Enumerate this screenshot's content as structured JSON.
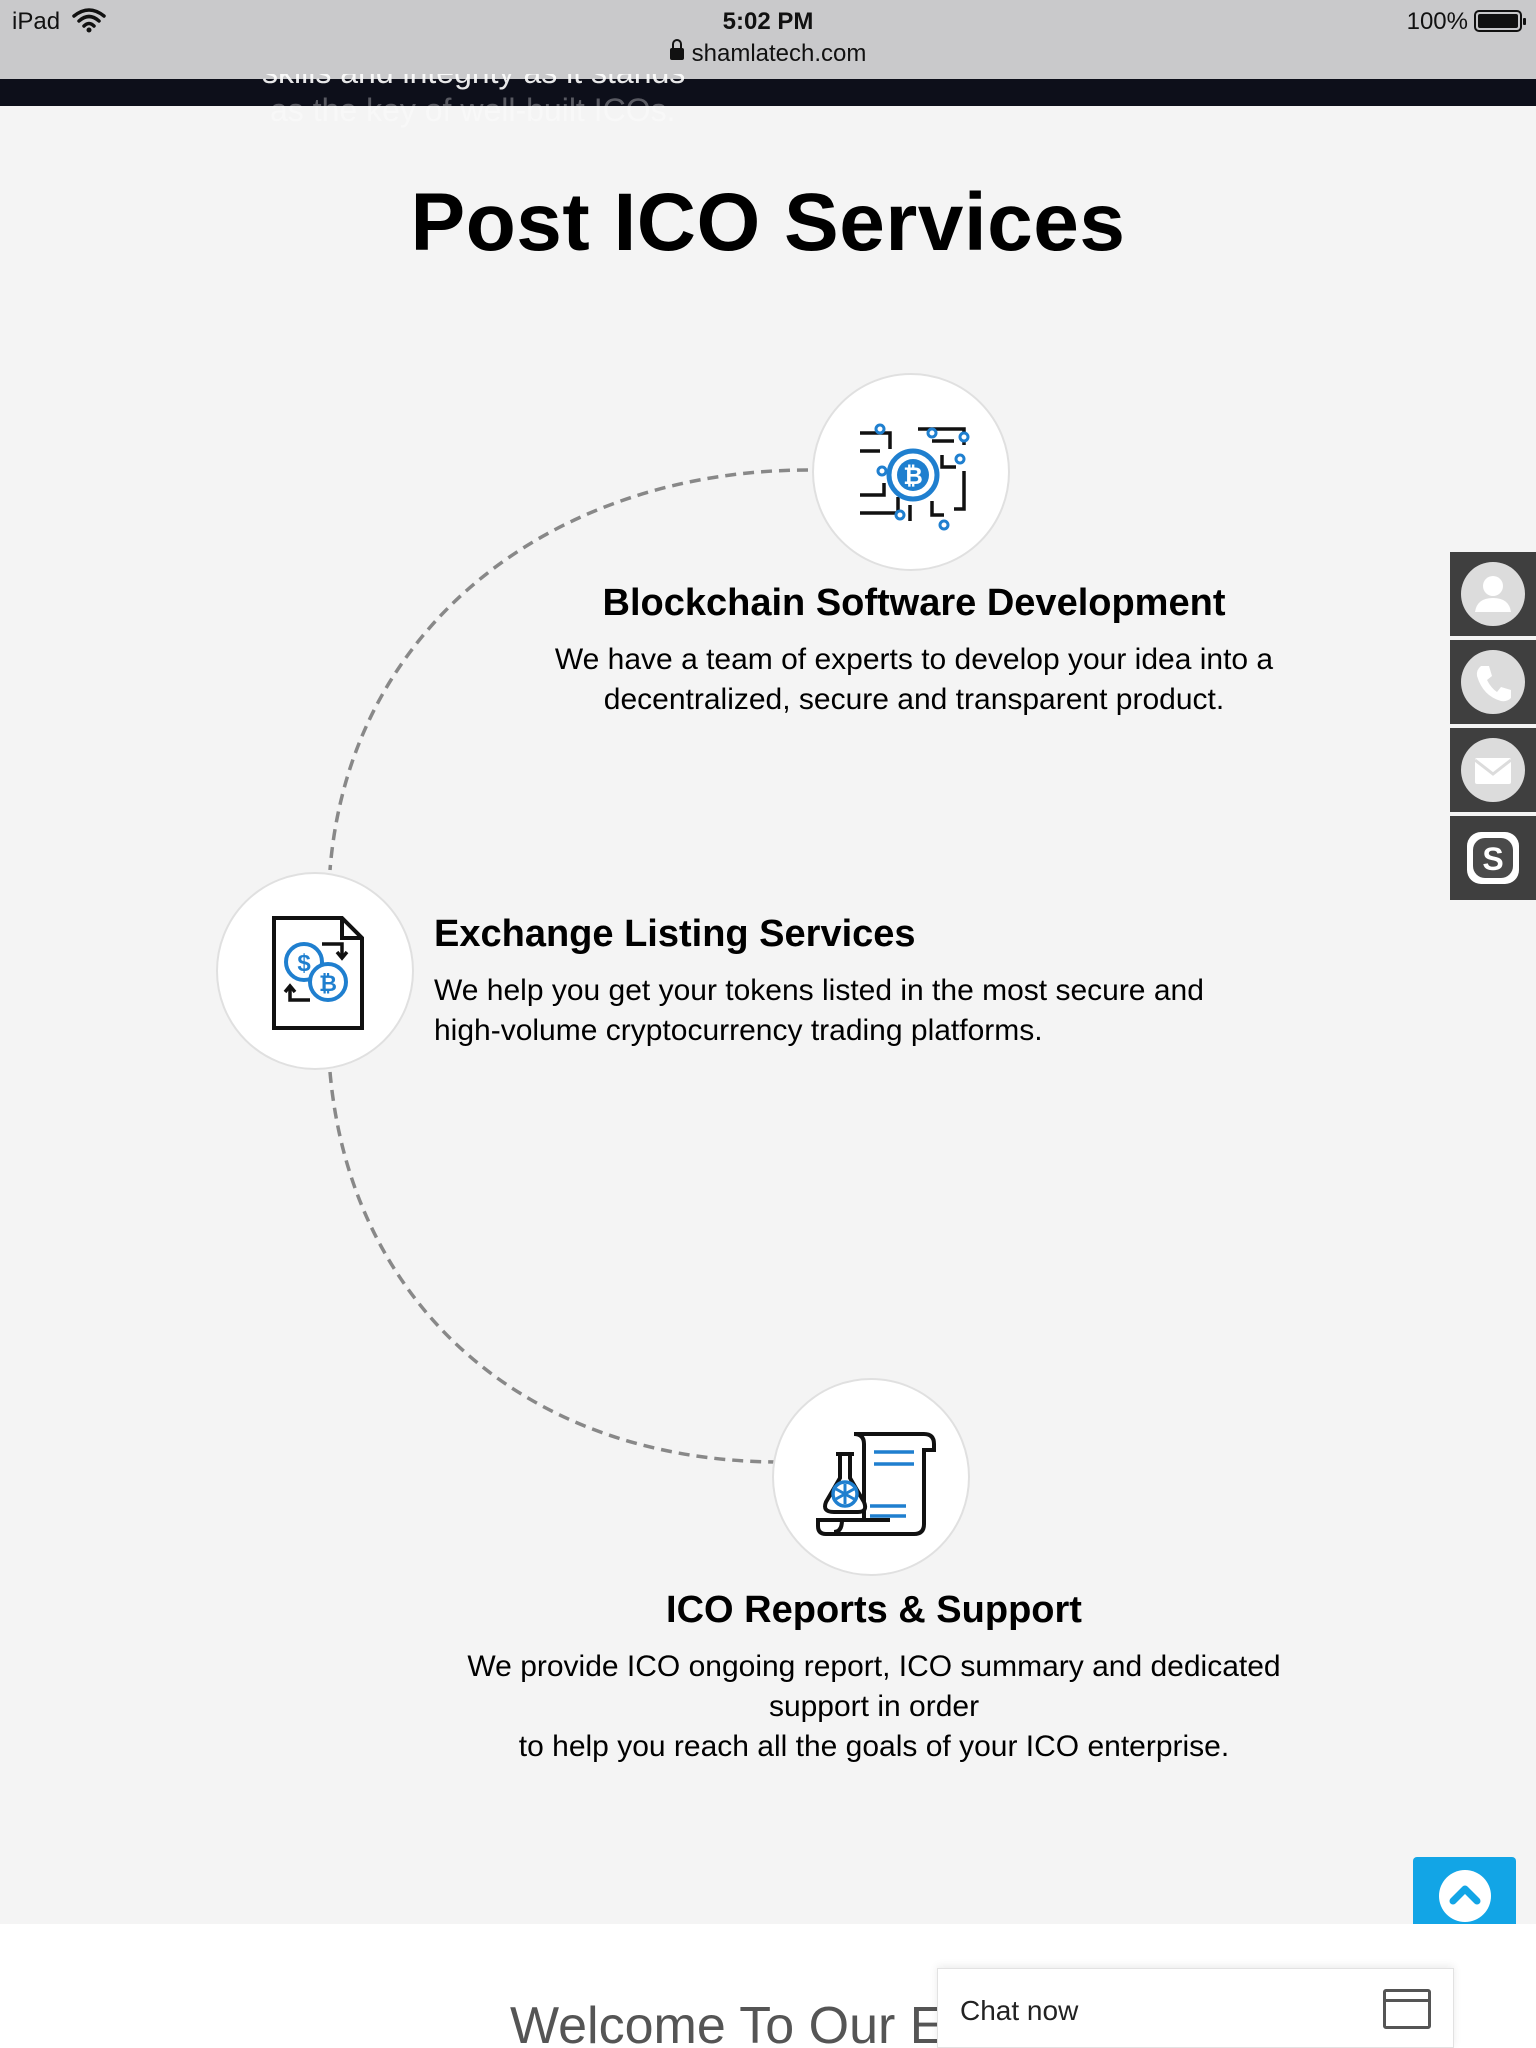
{
  "status_bar": {
    "device": "iPad",
    "time": "5:02 PM",
    "battery": "100%",
    "url": "shamlatech.com"
  },
  "hero": {
    "text_line1": "skills and integrity as it stands",
    "text_line2": "as the key of well-built ICOs."
  },
  "page_title": "Post ICO Services",
  "services": [
    {
      "title": "Blockchain Software Development",
      "description": "We have a team of experts to develop your idea into a\ndecentralized, secure and transparent product.",
      "icon": "bitcoin-circuit-icon"
    },
    {
      "title": "Exchange Listing Services",
      "description": "We help you get your tokens listed in the most secure and\nhigh-volume cryptocurrency trading platforms.",
      "icon": "dollar-bitcoin-exchange-icon"
    },
    {
      "title": "ICO Reports & Support",
      "description": "We provide ICO ongoing report, ICO summary and dedicated\nsupport in order\nto help you reach all the goals of your ICO enterprise.",
      "icon": "report-scroll-icon"
    }
  ],
  "side_contact": [
    "user-icon",
    "phone-icon",
    "mail-icon",
    "skype-icon"
  ],
  "welcome_text": "Welcome To Our E",
  "chat": {
    "label": "Chat now"
  },
  "colors": {
    "accent": "#12a5e6",
    "icon_blue": "#1f7fcf",
    "side_bar": "#3f3f3f"
  }
}
